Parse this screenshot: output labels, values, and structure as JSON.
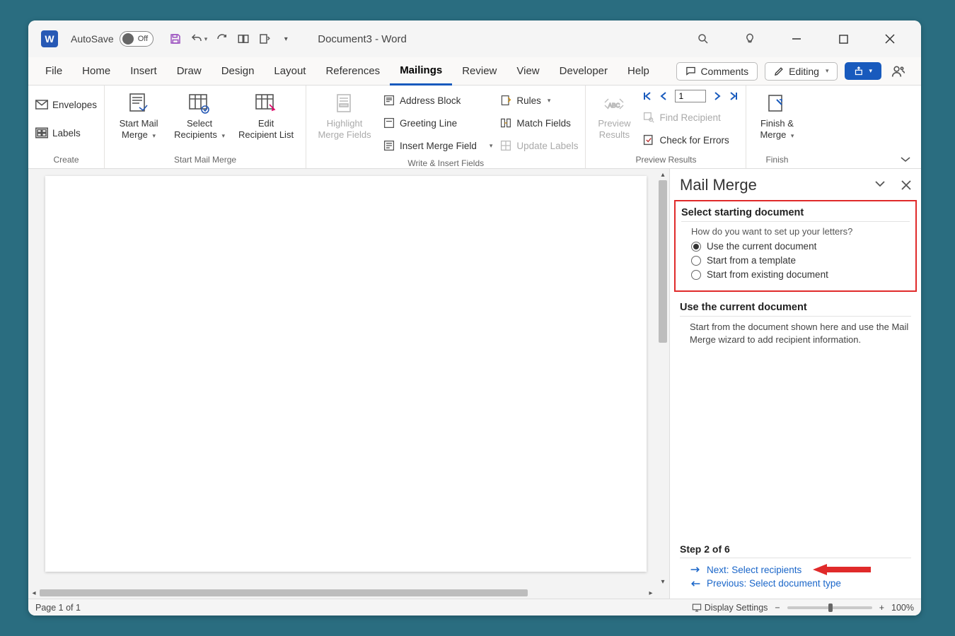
{
  "title": {
    "autosave_label": "AutoSave",
    "autosave_state": "Off",
    "doc": "Document3  -  Word"
  },
  "tabs": {
    "list": [
      "File",
      "Home",
      "Insert",
      "Draw",
      "Design",
      "Layout",
      "References",
      "Mailings",
      "Review",
      "View",
      "Developer",
      "Help"
    ],
    "active": "Mailings",
    "comments": "Comments",
    "editing": "Editing"
  },
  "ribbon": {
    "create": {
      "envelopes": "Envelopes",
      "labels": "Labels",
      "group": "Create"
    },
    "start": {
      "start": "Start Mail Merge",
      "select": "Select Recipients",
      "edit": "Edit Recipient List",
      "group": "Start Mail Merge"
    },
    "write": {
      "highlight": "Highlight Merge Fields",
      "addr": "Address Block",
      "greet": "Greeting Line",
      "insert": "Insert Merge Field",
      "rules": "Rules",
      "match": "Match Fields",
      "update": "Update Labels",
      "group": "Write & Insert Fields"
    },
    "preview": {
      "label": "Preview Results",
      "record": "1",
      "find": "Find Recipient",
      "check": "Check for Errors",
      "group": "Preview Results"
    },
    "finish": {
      "label": "Finish & Merge",
      "group": "Finish"
    }
  },
  "panel": {
    "title": "Mail Merge",
    "sect1": "Select starting document",
    "q": "How do you want to set up your letters?",
    "opts": [
      "Use the current document",
      "Start from a template",
      "Start from existing document"
    ],
    "opt_selected": 0,
    "sect2": "Use the current document",
    "desc": "Start from the document shown here and use the Mail Merge wizard to add recipient information.",
    "step": "Step 2 of 6",
    "next": "Next: Select recipients",
    "prev": "Previous: Select document type"
  },
  "status": {
    "page": "Page 1 of 1",
    "display": "Display Settings",
    "zoom": "100%"
  }
}
